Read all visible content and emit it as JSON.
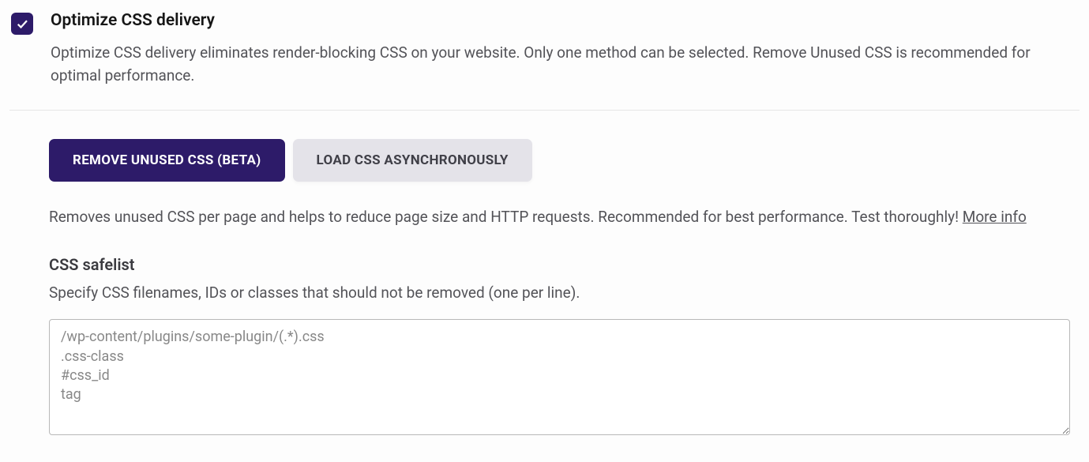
{
  "option": {
    "title": "Optimize CSS delivery",
    "description": "Optimize CSS delivery eliminates render-blocking CSS on your website. Only one method can be selected. Remove Unused CSS is recommended for optimal performance.",
    "checked": true
  },
  "tabs": {
    "active_label": "REMOVE UNUSED CSS (BETA)",
    "inactive_label": "LOAD CSS ASYNCHRONOUSLY",
    "description": "Removes unused CSS per page and helps to reduce page size and HTTP requests. Recommended for best performance. Test thoroughly! ",
    "more_info_label": "More info"
  },
  "safelist": {
    "title": "CSS safelist",
    "description": "Specify CSS filenames, IDs or classes that should not be removed (one per line).",
    "placeholder": "/wp-content/plugins/some-plugin/(.*).css\n.css-class\n#css_id\ntag",
    "value": ""
  }
}
